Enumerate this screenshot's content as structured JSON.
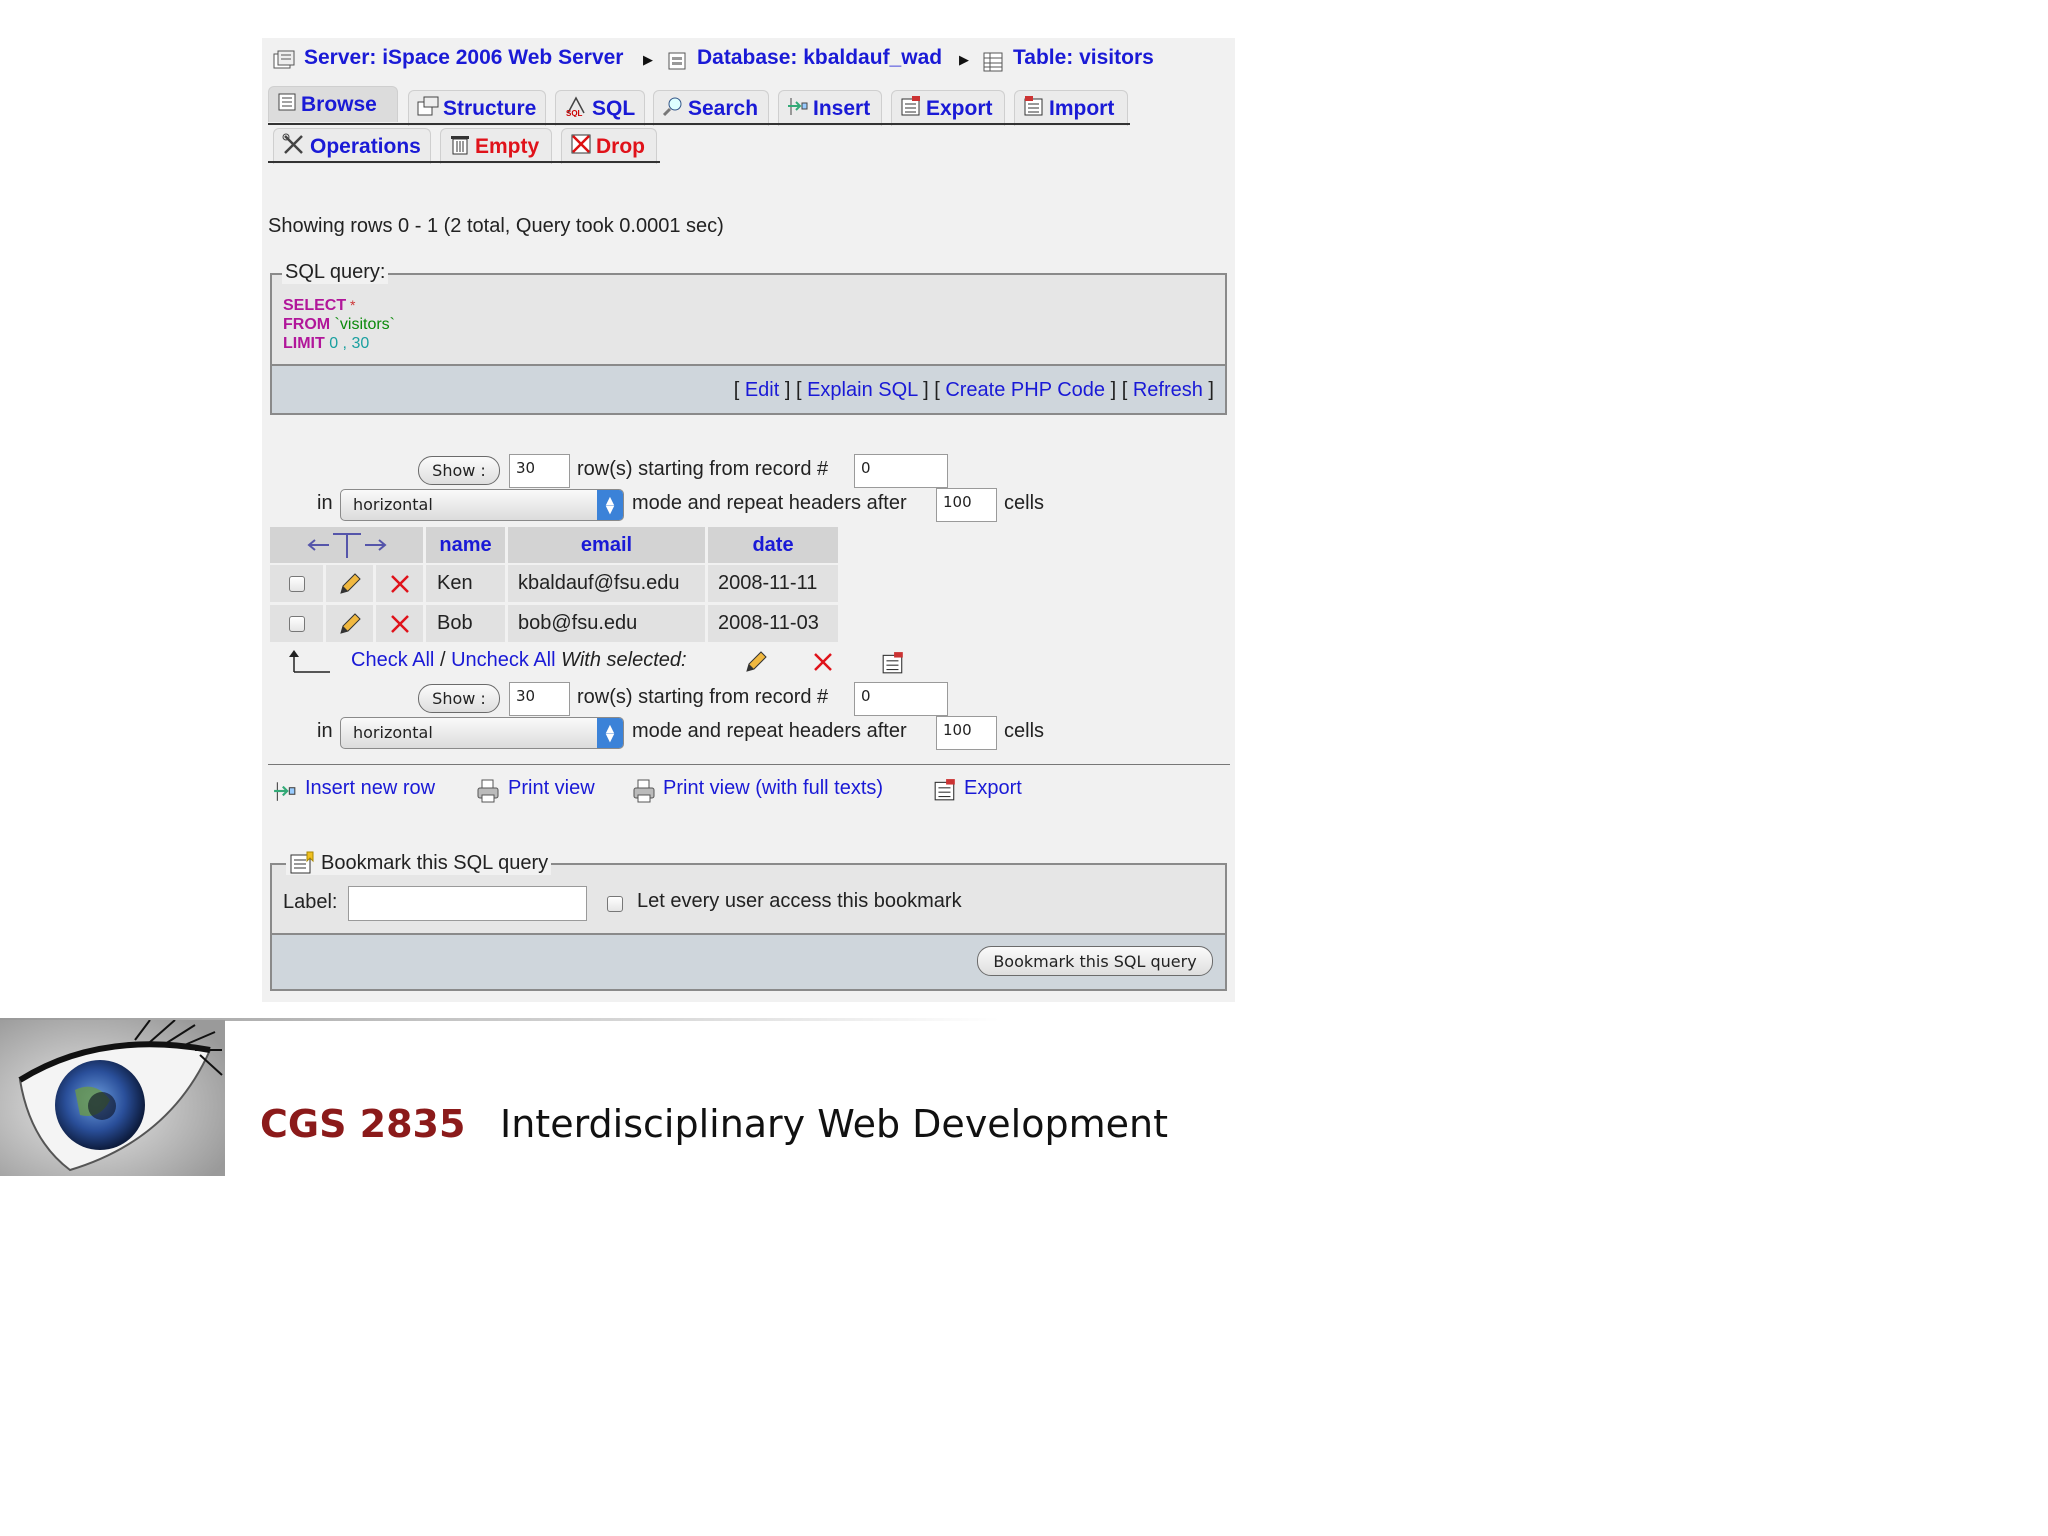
{
  "breadcrumb": {
    "server": "Server: iSpace 2006 Web Server",
    "database": "Database: kbaldauf_wad",
    "table": "Table: visitors"
  },
  "tabs": {
    "browse": "Browse",
    "structure": "Structure",
    "sql": "SQL",
    "search": "Search",
    "insert": "Insert",
    "export": "Export",
    "import": "Import",
    "operations": "Operations",
    "empty": "Empty",
    "drop": "Drop"
  },
  "status_text": "Showing rows 0 - 1 (2 total, Query took 0.0001 sec)",
  "sql_box": {
    "legend": "SQL query:",
    "line1_kw": "SELECT",
    "line1_rest": " *",
    "line2_kw": "FROM",
    "line2_rest": " `visitors`",
    "line3_kw": "LIMIT",
    "line3_rest": " 0 , 30",
    "edit": "Edit",
    "explain": "Explain SQL",
    "php": "Create PHP Code",
    "refresh": "Refresh"
  },
  "nav": {
    "show_label": "Show :",
    "rows_value": "30",
    "rows_text": "row(s) starting from record #",
    "start_value": "0",
    "in_text": "in",
    "mode_value": "horizontal",
    "mode_text": "mode and repeat headers after",
    "headers_value": "100",
    "cells_text": "cells"
  },
  "table": {
    "columns": [
      "name",
      "email",
      "date"
    ],
    "rows": [
      {
        "name": "Ken",
        "email": "kbaldauf@fsu.edu",
        "date": "2008-11-11"
      },
      {
        "name": "Bob",
        "email": "bob@fsu.edu",
        "date": "2008-11-03"
      }
    ],
    "check_all": "Check All",
    "slash": "/",
    "uncheck_all": "Uncheck All",
    "with_selected": "With selected:"
  },
  "actions": {
    "insert_row": "Insert new row",
    "print_view": "Print view",
    "print_full": "Print view (with full texts)",
    "export": "Export"
  },
  "bookmark": {
    "legend": "Bookmark this SQL query",
    "label": "Label:",
    "label_value": "",
    "let_every": "Let every user access this bookmark",
    "button": "Bookmark this SQL query"
  },
  "footer": {
    "course_code": "CGS 2835",
    "course_name": "Interdisciplinary Web Development"
  },
  "colors": {
    "link": "#1a1ad6",
    "danger": "#e0121a",
    "course_code": "#8b1a1a"
  }
}
